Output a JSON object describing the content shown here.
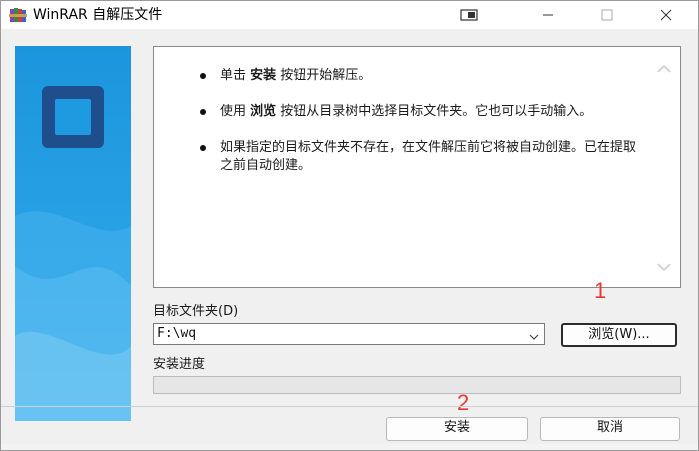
{
  "window": {
    "title": "WinRAR 自解压文件",
    "icon": "winrar-books-icon",
    "controls": [
      "restore-icon",
      "minimize-icon",
      "maximize-icon",
      "close-icon"
    ]
  },
  "banner": {
    "colors": {
      "top": "#1e9be0",
      "bottom": "#2fa8ec",
      "logo_frame": "#1f4e8c"
    }
  },
  "message": {
    "items": [
      {
        "prefix": "单击 ",
        "bold": "安装",
        "suffix": " 按钮开始解压。"
      },
      {
        "prefix": "使用 ",
        "bold": "浏览",
        "suffix": " 按钮从目录树中选择目标文件夹。它也可以手动输入。"
      },
      {
        "prefix": "如果指定的目标文件夹不存在，在文件解压前它将被自动创建。已在提取之前自动创建。",
        "bold": "",
        "suffix": ""
      }
    ]
  },
  "destination": {
    "label": "目标文件夹(D)",
    "value": "F:\\wq",
    "browse_label": "浏览(W)..."
  },
  "progress": {
    "label": "安装进度",
    "percent": 0
  },
  "buttons": {
    "install": "安装",
    "cancel": "取消"
  },
  "annotations": [
    "1",
    "2"
  ],
  "colors": {
    "annotation": "#e53935",
    "accent": "#1e9be0"
  }
}
